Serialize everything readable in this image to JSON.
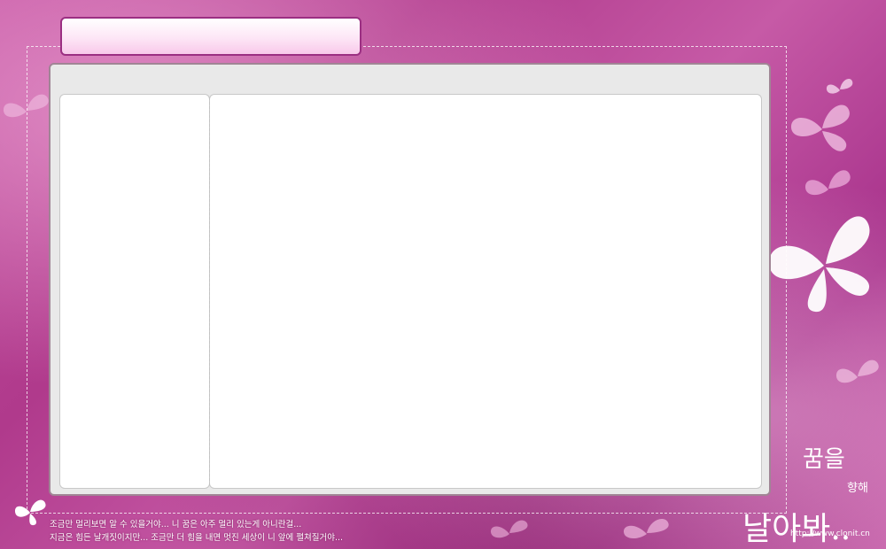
{
  "title_bar": {
    "title": ""
  },
  "footer": {
    "line1": "조금만 멀리보면 알 수 있을거야... 니 꿈은 아주 멀리 있는게 아니란걸...",
    "line2": "지금은 힘든 날개짓이지만... 조금만 더 힘을 내면 멋진 세상이 니 앞에 펼쳐질거야..."
  },
  "decoration": {
    "word1": "꿈을",
    "word2": "향해",
    "word3": "날아봐..",
    "url": "http://www.clonit.cn"
  },
  "colors": {
    "background": "#b8489a",
    "frame_border": "#9b2f82",
    "panel": "#e9e9e9",
    "pane": "#ffffff"
  }
}
